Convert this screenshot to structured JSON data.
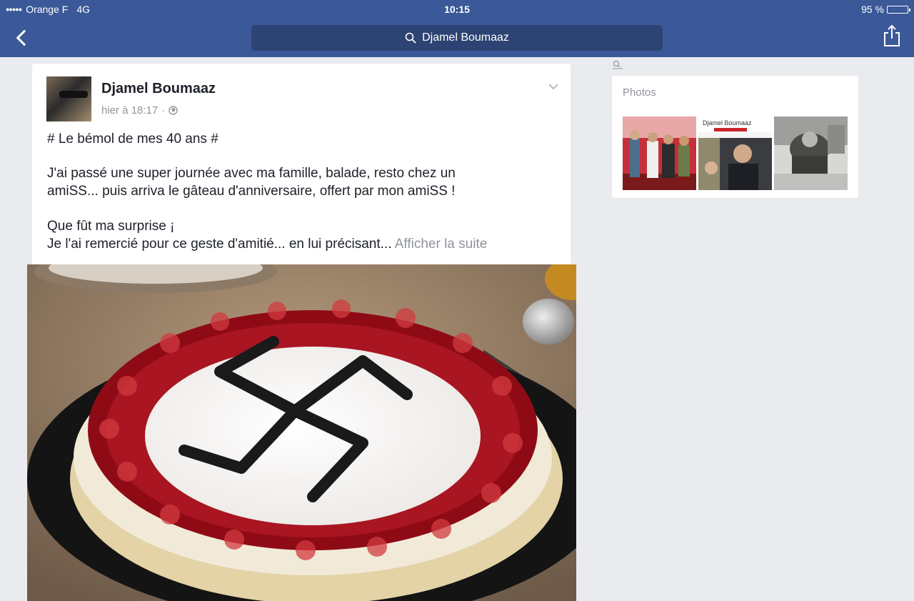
{
  "status_bar": {
    "carrier": "Orange F",
    "network": "4G",
    "time": "10:15",
    "battery_label": "95 %",
    "battery_level": 0.95
  },
  "nav": {
    "search_query": "Djamel Boumaaz"
  },
  "post": {
    "author": "Djamel Boumaaz",
    "timestamp": "hier à 18:17",
    "separator": "·",
    "lines": [
      "# Le bémol de mes 40 ans #",
      "J'ai passé une super journée avec ma famille, balade, resto chez un",
      "amiSS... puis arriva le gâteau d'anniversaire, offert par mon amiSS !",
      "Que fût ma surprise ¡",
      "Je l'ai remercié pour ce geste d'amitié... en lui précisant..."
    ],
    "see_more": "Afficher la suite"
  },
  "sidebar": {
    "photos_title": "Photos",
    "thumb_2_caption": "Djamel Boumaaz"
  },
  "colors": {
    "brand": "#3b5998",
    "search_bg": "#2d4374",
    "page_bg": "#e9ebee",
    "muted": "#90949c"
  },
  "icons": [
    "back-arrow-icon",
    "search-icon",
    "share-icon",
    "globe-icon",
    "chevron-down-icon",
    "photo-search-icon"
  ]
}
